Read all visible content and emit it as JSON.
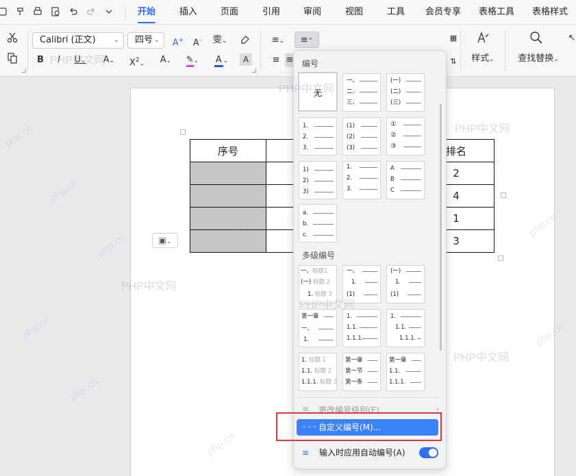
{
  "menubar": {
    "tabs": [
      {
        "label": "开始",
        "active": true
      },
      {
        "label": "插入"
      },
      {
        "label": "页面"
      },
      {
        "label": "引用"
      },
      {
        "label": "审阅"
      },
      {
        "label": "视图"
      },
      {
        "label": "工具"
      },
      {
        "label": "会员专享"
      },
      {
        "label": "表格工具"
      },
      {
        "label": "表格样式"
      }
    ]
  },
  "ribbon": {
    "font_name": "Calibri (正文)",
    "font_size": "四号",
    "styles_label": "样式",
    "find_replace_label": "查找替换"
  },
  "document": {
    "table": {
      "header_first": "序号",
      "header_last": "排名",
      "rank_values": [
        "2",
        "4",
        "1",
        "3"
      ]
    }
  },
  "numbering_panel": {
    "section_numbering": "编号",
    "none_label": "无",
    "section_multilevel": "多级编号",
    "presets": {
      "chinese_dun": [
        "一、",
        "二、",
        "三、"
      ],
      "chinese_paren": [
        "(一)",
        "(二)",
        "(三)"
      ],
      "arabic_dot": [
        "1.",
        "2.",
        "3."
      ],
      "arabic_paren": [
        "(1)",
        "(2)",
        "(3)"
      ],
      "circled": [
        "①",
        "②",
        "③"
      ],
      "arabic_halfparen": [
        "1)",
        "2)",
        "3)"
      ],
      "arabic_dot_indent": [
        "1.",
        "2.",
        "3."
      ],
      "upper_alpha": [
        "A",
        "B",
        "C"
      ],
      "lower_alpha": [
        "a.",
        "b.",
        "c."
      ]
    },
    "multilevel": {
      "ml1": [
        "一、",
        "标题1",
        "(一)",
        "标题 2",
        "1.",
        "标题 3"
      ],
      "ml2": [
        "一、",
        "1.",
        "(1)"
      ],
      "ml3": [
        "(一)",
        "1.",
        "(1)"
      ],
      "ml4": [
        "第一章",
        "一、",
        "1."
      ],
      "ml5": [
        "1.",
        "1.1.",
        "1.1.1."
      ],
      "ml6": [
        "1.",
        "1.1.",
        "1.1.1."
      ],
      "ml7": [
        "1.",
        "标题 1",
        "1.1.",
        "标题 2",
        "1.1.1.",
        "标题 3"
      ],
      "ml8": [
        "第一章",
        "第一节",
        "第一条"
      ],
      "ml9": [
        "第一章",
        "1.1.",
        "1.1.1."
      ]
    },
    "change_level_label": "更改编号级别(E)",
    "custom_label": "自定义编号(M)...",
    "auto_label": "输入时应用自动编号(A)",
    "auto_enabled": true
  },
  "watermarks": {
    "text_cn": "PHP中文网",
    "text_en": "php.cn"
  },
  "colors": {
    "accent": "#2b6cff",
    "highlight": "#3a82f7",
    "annotation_red": "#e0353b"
  }
}
